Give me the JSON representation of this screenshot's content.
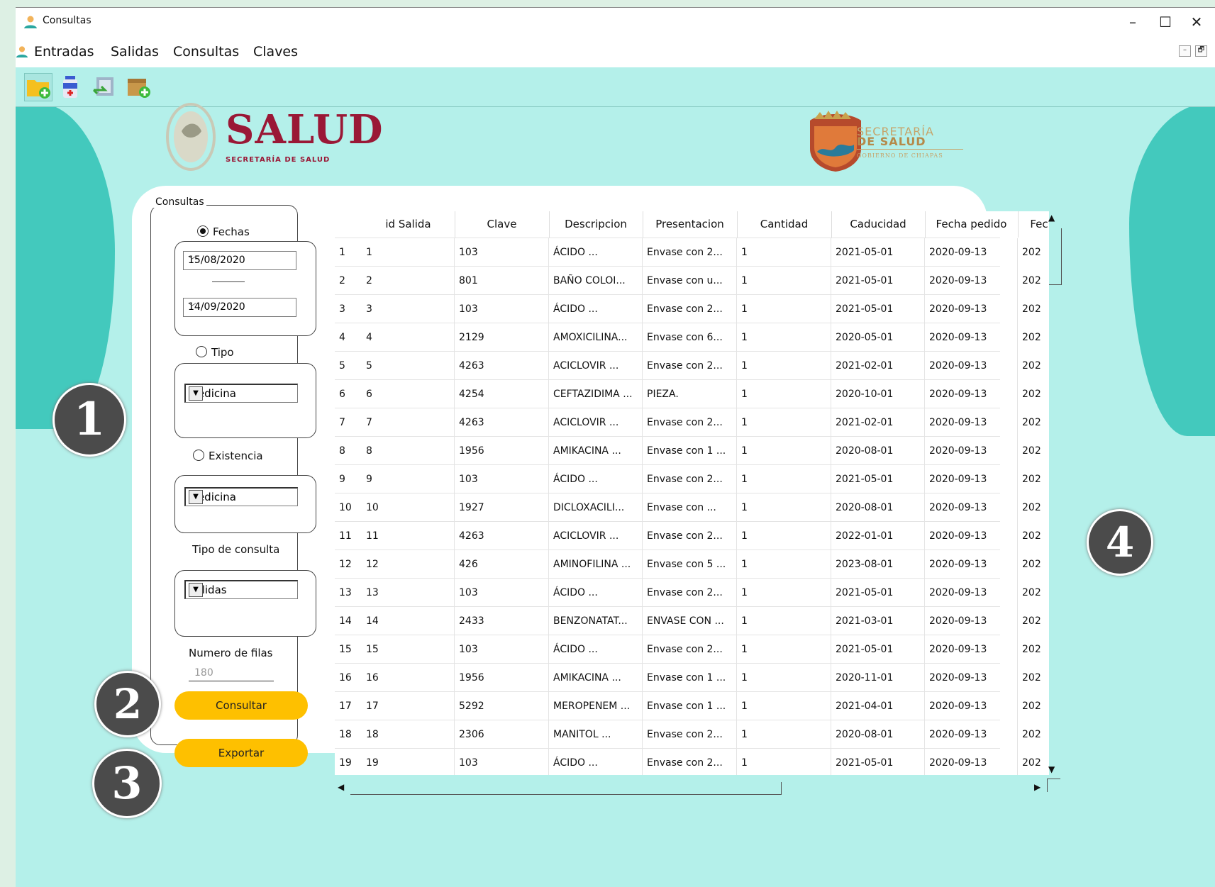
{
  "window": {
    "title": "Consultas",
    "minimize": "–",
    "maximize": "☐",
    "close": "✕",
    "mdi_min": "–",
    "mdi_restore": "🗗"
  },
  "menu": [
    "Entradas",
    "Salidas",
    "Consultas",
    "Claves"
  ],
  "toolbar": [
    "folder-add-icon",
    "medicine-user-icon",
    "transfer-icon",
    "box-add-icon"
  ],
  "header": {
    "salud": "SALUD",
    "salud_sub": "SECRETARÍA DE SALUD",
    "sec_top": "SECRETARÍA",
    "sec_mid": "DE SALUD",
    "sec_bot": "GOBIERNO DE CHIAPAS"
  },
  "panel": {
    "group_title": "Consultas",
    "fechas": "Fechas",
    "date_from": "15/08/2020",
    "date_to": "14/09/2020",
    "tipo": "Tipo",
    "tipo_value": "Medicina",
    "existencia": "Existencia",
    "existencia_value": "Medicina",
    "tipo_consulta": "Tipo de consulta",
    "tipo_consulta_value": "Salidas",
    "numero_filas": "Numero de filas",
    "numero_filas_placeholder": "180",
    "consultar": "Consultar",
    "exportar": "Exportar"
  },
  "badges": [
    "1",
    "2",
    "3",
    "4"
  ],
  "table": {
    "columns": [
      "id Salida",
      "Clave",
      "Descripcion",
      "Presentacion",
      "Cantidad",
      "Caducidad",
      "Fecha pedido",
      "Fec"
    ],
    "rows": [
      [
        "1",
        "1",
        "103",
        "ÁCIDO ...",
        "Envase con 2...",
        "1",
        "2021-05-01",
        "2020-09-13",
        "202"
      ],
      [
        "2",
        "2",
        "801",
        "BAÑO COLOI...",
        "Envase con u...",
        "1",
        "2021-05-01",
        "2020-09-13",
        "202"
      ],
      [
        "3",
        "3",
        "103",
        "ÁCIDO ...",
        "Envase con 2...",
        "1",
        "2021-05-01",
        "2020-09-13",
        "202"
      ],
      [
        "4",
        "4",
        "2129",
        "AMOXICILINA...",
        "Envase con 6...",
        "1",
        "2020-05-01",
        "2020-09-13",
        "202"
      ],
      [
        "5",
        "5",
        "4263",
        "ACICLOVIR ...",
        "Envase con 2...",
        "1",
        "2021-02-01",
        "2020-09-13",
        "202"
      ],
      [
        "6",
        "6",
        "4254",
        "CEFTAZIDIMA ...",
        "PIEZA.",
        "1",
        "2020-10-01",
        "2020-09-13",
        "202"
      ],
      [
        "7",
        "7",
        "4263",
        "ACICLOVIR ...",
        "Envase con 2...",
        "1",
        "2021-02-01",
        "2020-09-13",
        "202"
      ],
      [
        "8",
        "8",
        "1956",
        "AMIKACINA ...",
        "Envase con 1 ...",
        "1",
        "2020-08-01",
        "2020-09-13",
        "202"
      ],
      [
        "9",
        "9",
        "103",
        "ÁCIDO ...",
        "Envase con 2...",
        "1",
        "2021-05-01",
        "2020-09-13",
        "202"
      ],
      [
        "10",
        "10",
        "1927",
        "DICLOXACILI...",
        "Envase con ...",
        "1",
        "2020-08-01",
        "2020-09-13",
        "202"
      ],
      [
        "11",
        "11",
        "4263",
        "ACICLOVIR ...",
        "Envase con 2...",
        "1",
        "2022-01-01",
        "2020-09-13",
        "202"
      ],
      [
        "12",
        "12",
        "426",
        "AMINOFILINA ...",
        "Envase con 5 ...",
        "1",
        "2023-08-01",
        "2020-09-13",
        "202"
      ],
      [
        "13",
        "13",
        "103",
        "ÁCIDO ...",
        "Envase con 2...",
        "1",
        "2021-05-01",
        "2020-09-13",
        "202"
      ],
      [
        "14",
        "14",
        "2433",
        "BENZONATAT...",
        "ENVASE CON ...",
        "1",
        "2021-03-01",
        "2020-09-13",
        "202"
      ],
      [
        "15",
        "15",
        "103",
        "ÁCIDO ...",
        "Envase con 2...",
        "1",
        "2021-05-01",
        "2020-09-13",
        "202"
      ],
      [
        "16",
        "16",
        "1956",
        "AMIKACINA ...",
        "Envase con 1 ...",
        "1",
        "2020-11-01",
        "2020-09-13",
        "202"
      ],
      [
        "17",
        "17",
        "5292",
        "MEROPENEM ...",
        "Envase con 1 ...",
        "1",
        "2021-04-01",
        "2020-09-13",
        "202"
      ],
      [
        "18",
        "18",
        "2306",
        "MANITOL ...",
        "Envase con 2...",
        "1",
        "2020-08-01",
        "2020-09-13",
        "202"
      ],
      [
        "19",
        "19",
        "103",
        "ÁCIDO ...",
        "Envase con 2...",
        "1",
        "2021-05-01",
        "2020-09-13",
        "202"
      ]
    ]
  },
  "colors": {
    "background": "#b4f0ea",
    "blob": "#43c9bd",
    "button": "#fec000",
    "brand": "#9a1836",
    "gold": "#c6a46a"
  }
}
